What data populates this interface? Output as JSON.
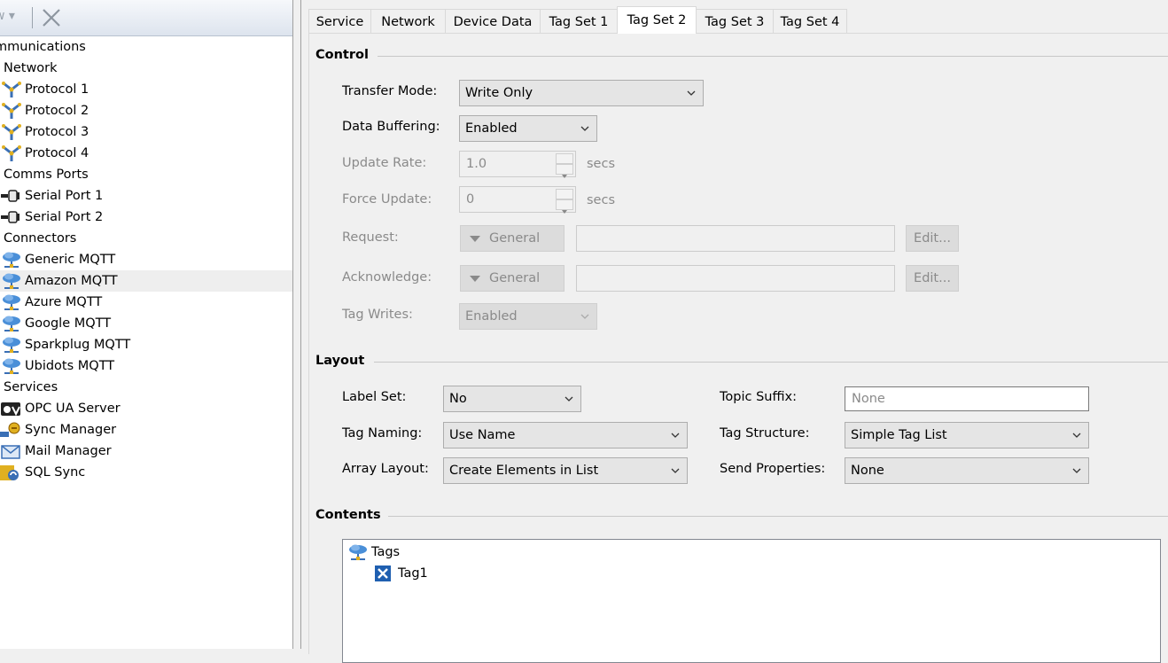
{
  "toolbar": {
    "new_label": "w",
    "close_tooltip": ""
  },
  "tree": {
    "items": [
      {
        "label": "mmunications"
      },
      {
        "label": "Network"
      },
      {
        "label": "Protocol 1"
      },
      {
        "label": "Protocol 2"
      },
      {
        "label": "Protocol 3"
      },
      {
        "label": "Protocol 4"
      },
      {
        "label": "Comms Ports"
      },
      {
        "label": "Serial Port 1"
      },
      {
        "label": "Serial Port 2"
      },
      {
        "label": "Connectors"
      },
      {
        "label": "Generic MQTT"
      },
      {
        "label": "Amazon MQTT"
      },
      {
        "label": "Azure MQTT"
      },
      {
        "label": "Google MQTT"
      },
      {
        "label": "Sparkplug MQTT"
      },
      {
        "label": "Ubidots MQTT"
      },
      {
        "label": "Services"
      },
      {
        "label": "OPC UA Server"
      },
      {
        "label": "Sync Manager"
      },
      {
        "label": "Mail Manager"
      },
      {
        "label": "SQL Sync"
      }
    ],
    "selected": "Amazon MQTT"
  },
  "tabs": [
    {
      "label": "Service"
    },
    {
      "label": "Network"
    },
    {
      "label": "Device Data"
    },
    {
      "label": "Tag Set 1"
    },
    {
      "label": "Tag Set 2"
    },
    {
      "label": "Tag Set 3"
    },
    {
      "label": "Tag Set 4"
    }
  ],
  "active_tab": "Tag Set 2",
  "control": {
    "title": "Control",
    "transfer_mode_label": "Transfer Mode:",
    "transfer_mode_value": "Write Only",
    "data_buffering_label": "Data Buffering:",
    "data_buffering_value": "Enabled",
    "update_rate_label": "Update Rate:",
    "update_rate_value": "1.0",
    "update_rate_units": "secs",
    "force_update_label": "Force Update:",
    "force_update_value": "0",
    "force_update_units": "secs",
    "request_label": "Request:",
    "request_button": "General",
    "request_edit": "Edit...",
    "acknowledge_label": "Acknowledge:",
    "acknowledge_button": "General",
    "acknowledge_edit": "Edit...",
    "tag_writes_label": "Tag Writes:",
    "tag_writes_value": "Enabled"
  },
  "layout": {
    "title": "Layout",
    "label_set_label": "Label Set:",
    "label_set_value": "No",
    "tag_naming_label": "Tag Naming:",
    "tag_naming_value": "Use Name",
    "array_layout_label": "Array Layout:",
    "array_layout_value": "Create Elements in List",
    "topic_suffix_label": "Topic Suffix:",
    "topic_suffix_placeholder": "None",
    "tag_structure_label": "Tag Structure:",
    "tag_structure_value": "Simple Tag List",
    "send_properties_label": "Send Properties:",
    "send_properties_value": "None"
  },
  "contents": {
    "title": "Contents",
    "root_label": "Tags",
    "child_label": "Tag1"
  },
  "colors": {
    "selected_row": "#eeeeee",
    "disabled_text": "#8a8a8a",
    "cloud_blue": "#4a8fd8"
  }
}
